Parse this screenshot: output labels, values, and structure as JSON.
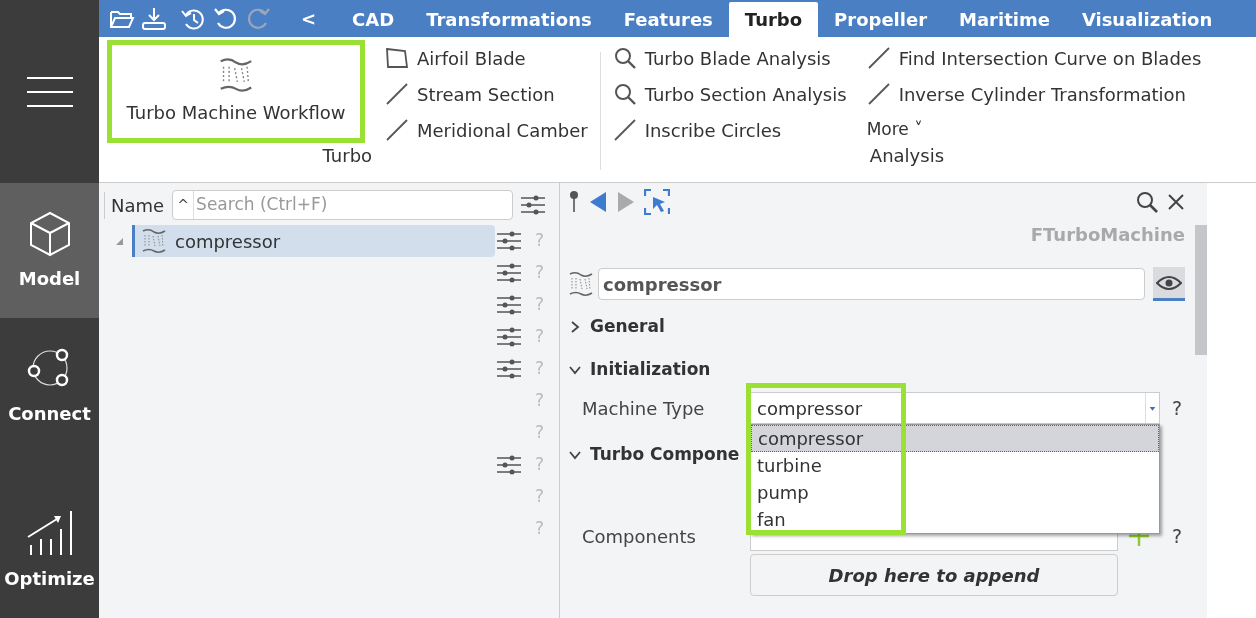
{
  "sidebar": {
    "items": [
      {
        "label": "Model",
        "selected": true
      },
      {
        "label": "Connect",
        "selected": false
      },
      {
        "label": "Optimize",
        "selected": false
      }
    ]
  },
  "toolbar": {
    "back": "<"
  },
  "tabs": [
    {
      "label": "CAD",
      "selected": false
    },
    {
      "label": "Transformations",
      "selected": false
    },
    {
      "label": "Features",
      "selected": false
    },
    {
      "label": "Turbo",
      "selected": true
    },
    {
      "label": "Propeller",
      "selected": false
    },
    {
      "label": "Maritime",
      "selected": false
    },
    {
      "label": "Visualization",
      "selected": false
    }
  ],
  "ribbon": {
    "groups": [
      {
        "label": "Turbo",
        "large": {
          "label": "Turbo Machine Workflow",
          "highlighted": true
        },
        "columns": [
          [
            {
              "label": "Airfoil Blade",
              "kind": "profile"
            },
            {
              "label": "Stream Section",
              "kind": "curve"
            },
            {
              "label": "Meridional Camber",
              "kind": "curve"
            }
          ]
        ]
      },
      {
        "label": "Analysis",
        "columns": [
          [
            {
              "label": "Turbo Blade Analysis",
              "kind": "analysis"
            },
            {
              "label": "Turbo Section Analysis",
              "kind": "analysis"
            },
            {
              "label": "Inscribe Circles",
              "kind": "curve"
            }
          ],
          [
            {
              "label": "Find Intersection Curve on Blades",
              "kind": "curve"
            },
            {
              "label": "Inverse Cylinder Transformation",
              "kind": "curve"
            },
            {
              "label": "More ˅",
              "kind": "menu"
            }
          ]
        ]
      }
    ]
  },
  "tree": {
    "column": "Name",
    "search_placeholder": "Search (Ctrl+F)",
    "sort": "^",
    "items": [
      {
        "label": "compressor",
        "selected": true,
        "expanded": true
      }
    ],
    "row_controls": [
      {
        "settings": true,
        "help": "?"
      },
      {
        "settings": true,
        "help": "?"
      },
      {
        "settings": true,
        "help": "?"
      },
      {
        "settings": true,
        "help": "?"
      },
      {
        "settings": true,
        "help": "?"
      },
      {
        "settings": false,
        "help": "?"
      },
      {
        "settings": false,
        "help": "?"
      },
      {
        "settings": true,
        "help": "?"
      },
      {
        "settings": false,
        "help": "?"
      },
      {
        "settings": false,
        "help": "?"
      }
    ]
  },
  "properties": {
    "type": "FTurboMachine",
    "name": "compressor",
    "visible": true,
    "sections": [
      {
        "label": "General",
        "expanded": false
      },
      {
        "label": "Initialization",
        "expanded": true
      },
      {
        "label": "Turbo Compone",
        "expanded": true
      }
    ],
    "machine_type": {
      "label": "Machine Type",
      "value": "compressor",
      "help": "?",
      "highlighted": true,
      "options": [
        {
          "label": "compressor",
          "selected": true
        },
        {
          "label": "turbine",
          "selected": false
        },
        {
          "label": "pump",
          "selected": false
        },
        {
          "label": "fan",
          "selected": false
        }
      ]
    },
    "components": {
      "label": "Components",
      "help": "?",
      "drop": "Drop here to append"
    }
  }
}
